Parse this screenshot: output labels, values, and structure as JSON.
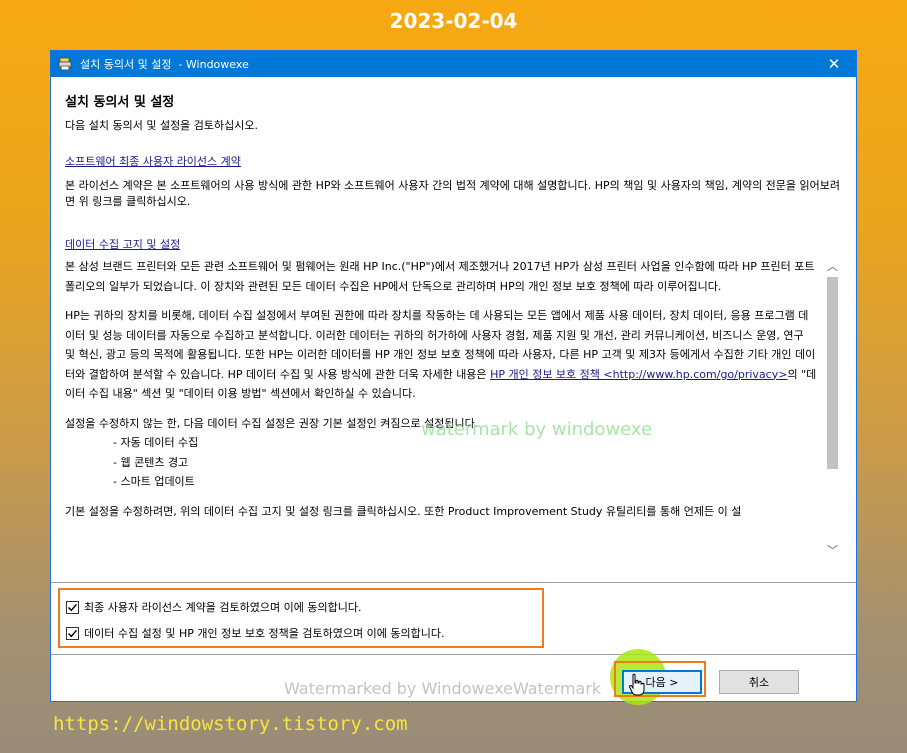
{
  "background": {
    "date": "2023-02-04",
    "url": "https://windowstory.tistory.com",
    "watermark_green": "watermark by windowexe",
    "watermark_gray": "Watermarked by WindowexeWatermark"
  },
  "window": {
    "title": "설치 동의서 및 설정  - Windowexe",
    "close_glyph": "✕",
    "accent_color": "#0078d7"
  },
  "header": {
    "title": "설치 동의서 및 설정",
    "subtitle": "다음 설치 동의서 및 설정을 검토하십시오."
  },
  "eula": {
    "link": "소프트웨어 최종 사용자 라이선스 계약",
    "text": "본 라이선스 계약은 본 소프트웨어의 사용 방식에 관한 HP와 소프트웨어 사용자 간의 법적 계약에 대해 설명합니다. HP의 책임 및 사용자의 책임, 계약의 전문을 읽어보려면 위 링크를 클릭하십시오."
  },
  "data_collection": {
    "link": "데이터 수집 고지 및 설정",
    "para1": "본 삼성 브랜드 프린터와 모든 관련 소프트웨어 및 펌웨어는 원래 HP Inc.(\"HP\")에서 제조했거나 2017년 HP가 삼성 프린터 사업을 인수함에 따라 HP 프린터 포트폴리오의 일부가 되었습니다.  이 장치와 관련된 모든 데이터 수집은 HP에서 단독으로 관리하며 HP의 개인 정보 보호 정책에 따라 이루어집니다.",
    "para2_a": "HP는 귀하의 장치를 비롯해, 데이터 수집 설정에서 부여된 권한에 따라 장치를 작동하는 데 사용되는 모든 앱에서 제품 사용 데이터, 장치 데이터, 응용 프로그램 데이터 및 성능 데이터를 자동으로 수집하고 분석합니다. 이러한 데이터는 귀하의 허가하에 사용자 경험, 제품 지원 및 개선, 관리 커뮤니케이션, 비즈니스 운영, 연구 및 혁신, 광고 등의 목적에 활용됩니다. 또한 HP는 이러한 데이터를 HP 개인 정보 보호 정책에 따라 사용자, 다른 HP 고객 및 제3자 등에게서 수집한 기타 개인 데이터와 결합하여 분석할 수 있습니다. HP 데이터 수집 및 사용 방식에 관한 더욱 자세한 내용은 ",
    "privacy_link": "HP 개인 정보 보호 정책 <http://www.hp.com/go/privacy>",
    "para2_b": "의 \"데이터 수집 내용\" 섹션 및 \"데이터 이용 방법\" 섹션에서 확인하실 수 있습니다.",
    "para3": "설정을 수정하지 않는 한, 다음 데이터 수집 설정은 권장 기본 설정인 켜짐으로 설정됩니다.",
    "items": [
      "- 자동 데이터 수집",
      "- 웹 콘텐츠 경고",
      "- 스마트 업데이트"
    ],
    "para4": "기본 설정을 수정하려면, 위의 데이터 수집 고지 및 설정 링크를 클릭하십시오.  또한 Product Improvement Study 유틸리티를 통해 언제든 이 설"
  },
  "scrollbar": {
    "up": "︿",
    "down": "﹀"
  },
  "agreements": {
    "eula_label": "최종 사용자 라이선스 계약을 검토하였으며 이에 동의합니다.",
    "eula_checked": true,
    "privacy_label": "데이터 수집 설정 및 HP 개인 정보 보호 정책을 검토하였으며 이에 동의합니다.",
    "privacy_checked": true,
    "highlight_color": "#f07a1c"
  },
  "buttons": {
    "next": "다음 >",
    "cancel": "취소"
  }
}
